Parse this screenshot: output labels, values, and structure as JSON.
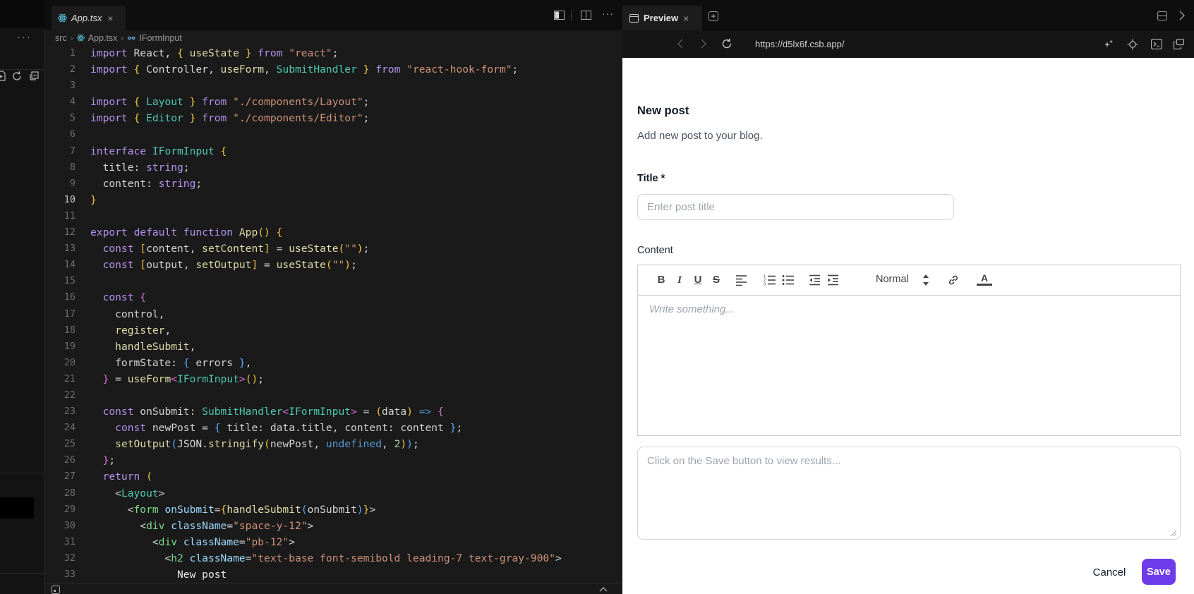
{
  "explorer": {
    "more_icon_glyph": "···"
  },
  "editor": {
    "tab": {
      "title": "App.tsx",
      "close_glyph": "×"
    },
    "breadcrumb": {
      "root": "src",
      "file": "App.tsx",
      "symbol": "IFormInput",
      "sep": "›"
    },
    "lines": [
      {
        "n": 1,
        "t": [
          [
            "k",
            "import "
          ],
          [
            "p",
            "React, "
          ],
          [
            "y",
            "{ "
          ],
          [
            "f",
            "useState"
          ],
          [
            "y",
            " }"
          ],
          [
            "k",
            " from "
          ],
          [
            "s",
            "\"react\""
          ],
          [
            "p",
            ";"
          ]
        ]
      },
      {
        "n": 2,
        "t": [
          [
            "k",
            "import "
          ],
          [
            "y",
            "{ "
          ],
          [
            "p",
            "Controller, "
          ],
          [
            "f",
            "useForm"
          ],
          [
            "p",
            ", "
          ],
          [
            "t",
            "SubmitHandler"
          ],
          [
            "y",
            " }"
          ],
          [
            "k",
            " from "
          ],
          [
            "s",
            "\"react-hook-form\""
          ],
          [
            "p",
            ";"
          ]
        ]
      },
      {
        "n": 3,
        "t": []
      },
      {
        "n": 4,
        "t": [
          [
            "k",
            "import "
          ],
          [
            "y",
            "{ "
          ],
          [
            "t",
            "Layout"
          ],
          [
            "y",
            " }"
          ],
          [
            "k",
            " from "
          ],
          [
            "s",
            "\"./components/Layout\""
          ],
          [
            "p",
            ";"
          ]
        ]
      },
      {
        "n": 5,
        "t": [
          [
            "k",
            "import "
          ],
          [
            "y",
            "{ "
          ],
          [
            "t",
            "Editor"
          ],
          [
            "y",
            " }"
          ],
          [
            "k",
            " from "
          ],
          [
            "s",
            "\"./components/Editor\""
          ],
          [
            "p",
            ";"
          ]
        ]
      },
      {
        "n": 6,
        "t": []
      },
      {
        "n": 7,
        "t": [
          [
            "k",
            "interface "
          ],
          [
            "t",
            "IFormInput "
          ],
          [
            "y",
            "{"
          ]
        ]
      },
      {
        "n": 8,
        "t": [
          [
            "p",
            "  title: "
          ],
          [
            "k",
            "string"
          ],
          [
            "p",
            ";"
          ]
        ]
      },
      {
        "n": 9,
        "t": [
          [
            "p",
            "  content: "
          ],
          [
            "k",
            "string"
          ],
          [
            "p",
            ";"
          ]
        ]
      },
      {
        "n": 10,
        "active": true,
        "t": [
          [
            "y",
            "}"
          ]
        ]
      },
      {
        "n": 11,
        "t": []
      },
      {
        "n": 12,
        "t": [
          [
            "k",
            "export default function "
          ],
          [
            "f",
            "App"
          ],
          [
            "y",
            "()"
          ],
          [
            "p",
            " "
          ],
          [
            "y",
            "{"
          ]
        ]
      },
      {
        "n": 13,
        "t": [
          [
            "p",
            "  "
          ],
          [
            "k",
            "const "
          ],
          [
            "y",
            "["
          ],
          [
            "p",
            "content, "
          ],
          [
            "f",
            "setContent"
          ],
          [
            "y",
            "]"
          ],
          [
            "p",
            " = "
          ],
          [
            "f",
            "useState"
          ],
          [
            "y",
            "("
          ],
          [
            "s",
            "\"\""
          ],
          [
            "y",
            ")"
          ],
          [
            "p",
            ";"
          ]
        ]
      },
      {
        "n": 14,
        "t": [
          [
            "p",
            "  "
          ],
          [
            "k",
            "const "
          ],
          [
            "y",
            "["
          ],
          [
            "p",
            "output, "
          ],
          [
            "f",
            "setOutput"
          ],
          [
            "y",
            "]"
          ],
          [
            "p",
            " = "
          ],
          [
            "f",
            "useState"
          ],
          [
            "y",
            "("
          ],
          [
            "s",
            "\"\""
          ],
          [
            "y",
            ")"
          ],
          [
            "p",
            ";"
          ]
        ]
      },
      {
        "n": 15,
        "t": []
      },
      {
        "n": 16,
        "t": [
          [
            "p",
            "  "
          ],
          [
            "k",
            "const "
          ],
          [
            "m",
            "{"
          ]
        ]
      },
      {
        "n": 17,
        "t": [
          [
            "p",
            "    control,"
          ]
        ]
      },
      {
        "n": 18,
        "t": [
          [
            "p",
            "    "
          ],
          [
            "f",
            "register"
          ],
          [
            "p",
            ","
          ]
        ]
      },
      {
        "n": 19,
        "t": [
          [
            "p",
            "    "
          ],
          [
            "f",
            "handleSubmit"
          ],
          [
            "p",
            ","
          ]
        ]
      },
      {
        "n": 20,
        "t": [
          [
            "p",
            "    formState: "
          ],
          [
            "b",
            "{ "
          ],
          [
            "p",
            "errors"
          ],
          [
            "b",
            " }"
          ],
          [
            "p",
            ","
          ]
        ]
      },
      {
        "n": 21,
        "t": [
          [
            "p",
            "  "
          ],
          [
            "m",
            "}"
          ],
          [
            "p",
            " = "
          ],
          [
            "f",
            "useForm"
          ],
          [
            "m",
            "<"
          ],
          [
            "t",
            "IFormInput"
          ],
          [
            "m",
            ">"
          ],
          [
            "y",
            "()"
          ],
          [
            "p",
            ";"
          ]
        ]
      },
      {
        "n": 22,
        "t": []
      },
      {
        "n": 23,
        "t": [
          [
            "p",
            "  "
          ],
          [
            "k",
            "const "
          ],
          [
            "p",
            "onSubmit: "
          ],
          [
            "t",
            "SubmitHandler"
          ],
          [
            "m",
            "<"
          ],
          [
            "t",
            "IFormInput"
          ],
          [
            "m",
            ">"
          ],
          [
            "p",
            " = "
          ],
          [
            "y",
            "("
          ],
          [
            "p",
            "data"
          ],
          [
            "y",
            ")"
          ],
          [
            "u",
            " => "
          ],
          [
            "m",
            "{"
          ]
        ]
      },
      {
        "n": 24,
        "t": [
          [
            "p",
            "    "
          ],
          [
            "k",
            "const "
          ],
          [
            "p",
            "newPost = "
          ],
          [
            "b",
            "{ "
          ],
          [
            "p",
            "title: data.title, content: content "
          ],
          [
            "b",
            "}"
          ],
          [
            "p",
            ";"
          ]
        ]
      },
      {
        "n": 25,
        "t": [
          [
            "p",
            "    "
          ],
          [
            "f",
            "setOutput"
          ],
          [
            "b",
            "("
          ],
          [
            "p",
            "JSON."
          ],
          [
            "f",
            "stringify"
          ],
          [
            "y",
            "("
          ],
          [
            "p",
            "newPost, "
          ],
          [
            "u",
            "undefined"
          ],
          [
            "p",
            ", "
          ],
          [
            "n2",
            "2"
          ],
          [
            "y",
            ")"
          ],
          [
            "b",
            ")"
          ],
          [
            "p",
            ";"
          ]
        ]
      },
      {
        "n": 26,
        "t": [
          [
            "p",
            "  "
          ],
          [
            "m",
            "}"
          ],
          [
            "p",
            ";"
          ]
        ]
      },
      {
        "n": 27,
        "t": [
          [
            "p",
            "  "
          ],
          [
            "k",
            "return "
          ],
          [
            "y",
            "("
          ]
        ]
      },
      {
        "n": 28,
        "t": [
          [
            "p",
            "    <"
          ],
          [
            "t",
            "Layout"
          ],
          [
            "p",
            ">"
          ]
        ]
      },
      {
        "n": 29,
        "t": [
          [
            "p",
            "      <"
          ],
          [
            "g",
            "form "
          ],
          [
            "a",
            "onSubmit"
          ],
          [
            "p",
            "="
          ],
          [
            "y",
            "{"
          ],
          [
            "f",
            "handleSubmit"
          ],
          [
            "b",
            "("
          ],
          [
            "p",
            "onSubmit"
          ],
          [
            "b",
            ")"
          ],
          [
            "y",
            "}"
          ],
          [
            "p",
            ">"
          ]
        ]
      },
      {
        "n": 30,
        "t": [
          [
            "p",
            "        <"
          ],
          [
            "g",
            "div "
          ],
          [
            "a",
            "className"
          ],
          [
            "p",
            "="
          ],
          [
            "s",
            "\"space-y-12\""
          ],
          [
            "p",
            ">"
          ]
        ]
      },
      {
        "n": 31,
        "t": [
          [
            "p",
            "          <"
          ],
          [
            "g",
            "div "
          ],
          [
            "a",
            "className"
          ],
          [
            "p",
            "="
          ],
          [
            "s",
            "\"pb-12\""
          ],
          [
            "p",
            ">"
          ]
        ]
      },
      {
        "n": 32,
        "t": [
          [
            "p",
            "            <"
          ],
          [
            "g",
            "h2 "
          ],
          [
            "a",
            "className"
          ],
          [
            "p",
            "="
          ],
          [
            "s",
            "\"text-base font-semibold leading-7 text-gray-900\""
          ],
          [
            "p",
            ">"
          ]
        ]
      },
      {
        "n": 33,
        "t": [
          [
            "p",
            "              "
          ],
          [
            "w",
            "New post"
          ]
        ]
      }
    ],
    "more_actions_glyph": "···"
  },
  "preview": {
    "tab": {
      "title": "Preview",
      "close_glyph": "×"
    },
    "url": "https://d5lx6f.csb.app/",
    "form": {
      "heading": "New post",
      "subheading": "Add new post to your blog.",
      "title_label": "Title *",
      "title_placeholder": "Enter post title",
      "content_label": "Content",
      "toolbar": {
        "bold": "B",
        "italic": "I",
        "underline": "U",
        "strike": "S",
        "format_label": "Normal"
      },
      "editor_placeholder": "Write something...",
      "output_placeholder": "Click on the Save button to view results...",
      "cancel_label": "Cancel",
      "save_label": "Save"
    }
  },
  "colors": {
    "accent": "#6D3BE9",
    "react_icon": "#58C4DC",
    "interface_icon": "#75BEFF"
  }
}
